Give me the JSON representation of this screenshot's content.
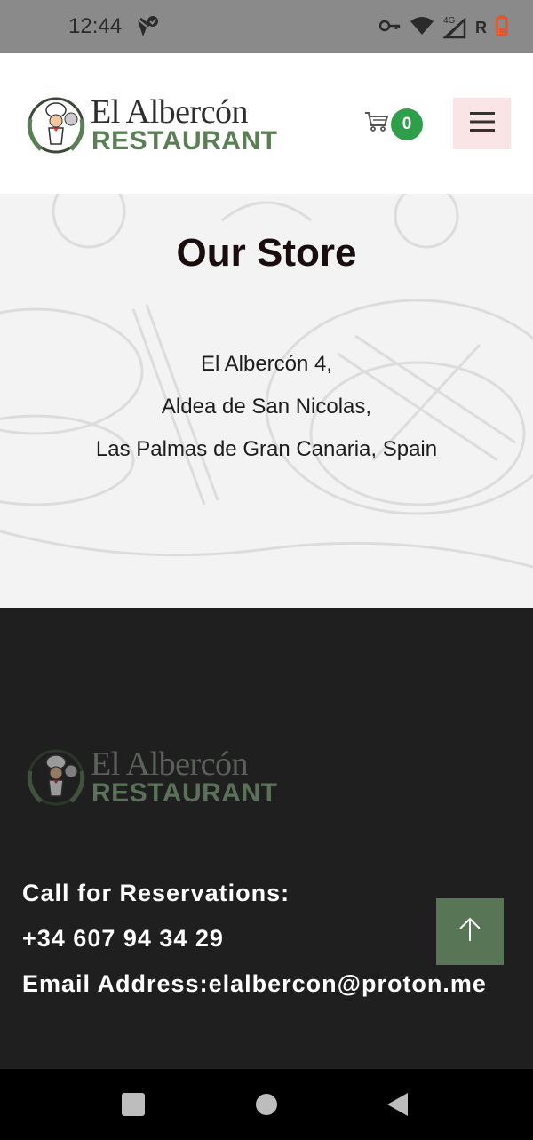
{
  "status_bar": {
    "time": "12:44",
    "network": "4G",
    "roaming": "R",
    "icons": [
      "maps-check-icon",
      "vpn-key-icon",
      "wifi-icon",
      "signal-icon",
      "battery-low-icon"
    ],
    "battery_color": "#e8542a"
  },
  "header": {
    "logo_title": "El Albercón",
    "logo_subtitle": "RESTAURANT",
    "logo_emblem_text": "EL ALBERCÓN",
    "cart_count": "0",
    "menu_icon": "hamburger-menu-icon"
  },
  "store": {
    "title": "Our Store",
    "address_lines": [
      "El Albercón 4,",
      "Aldea de San Nicolas,",
      "Las Palmas de Gran Canaria, Spain"
    ]
  },
  "footer": {
    "logo_title": "El Albercón",
    "logo_subtitle": "RESTAURANT",
    "reservations_label": "Call for Reservations:",
    "phone": "+34 607 94 34 29",
    "email_line": "Email Address:elalbercon@proton.me",
    "back_to_top_icon": "arrow-up-icon"
  },
  "nav_bar": {
    "buttons": [
      "recents-square-icon",
      "home-circle-icon",
      "back-triangle-icon"
    ]
  },
  "colors": {
    "accent_green": "#5a7f55",
    "badge_green": "#2e9e4a",
    "menu_bg": "#fbe4e6",
    "footer_bg": "#1f1f20"
  }
}
